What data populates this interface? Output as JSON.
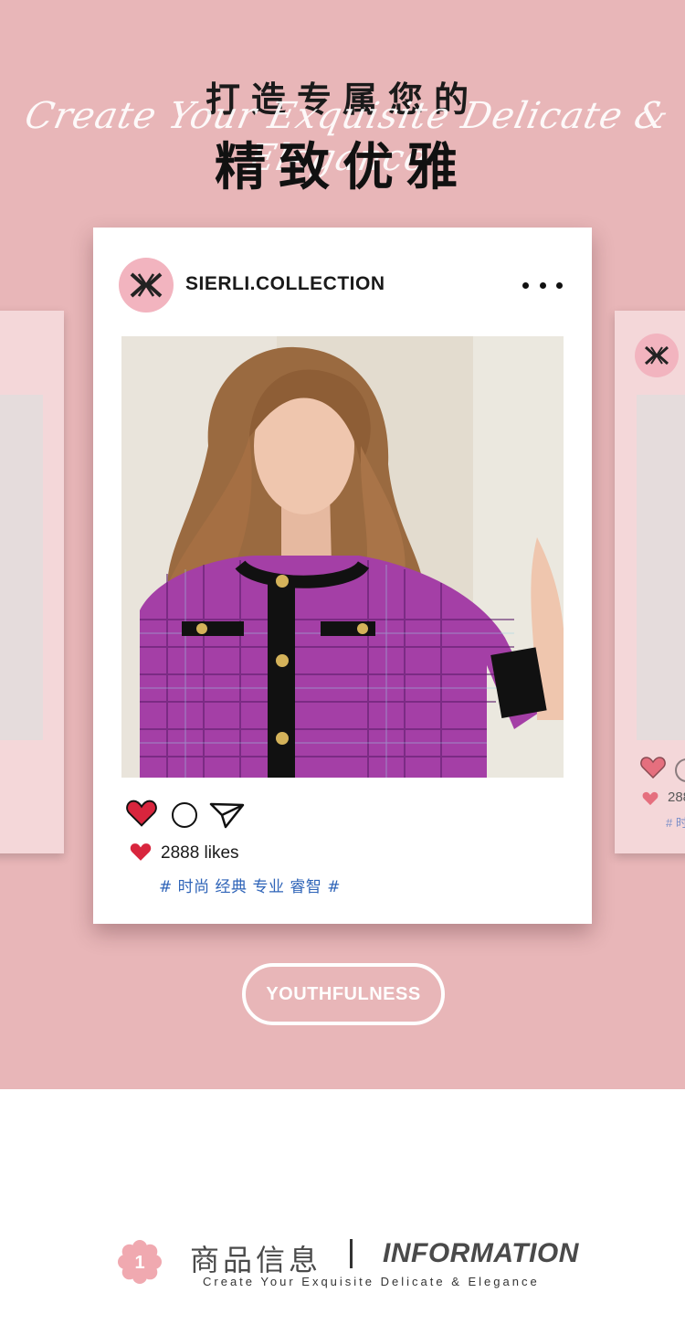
{
  "header": {
    "title_line1": "打造专属您的",
    "script_line": "Create Your Exquisite Delicate & Elegance",
    "title_line2": "精致优雅"
  },
  "post": {
    "account_name": "SIERLI.COLLECTION",
    "more_icon": "more-horizontal-icon",
    "actions": {
      "like_icon": "heart-icon",
      "comment_icon": "comment-icon",
      "share_icon": "send-icon"
    },
    "likes_text": "2888 likes",
    "hashtags": "# 时尚 经典 专业 睿智 #"
  },
  "side_card": {
    "likes_text": "288",
    "hashtag_fragment": "# 时"
  },
  "badge": {
    "label": "YOUTHFULNESS"
  },
  "info_section": {
    "number": "1",
    "title_cn": "商品信息",
    "title_en": "INFORMATION",
    "subtitle": "Create Your Exquisite Delicate & Elegance"
  },
  "colors": {
    "hero_background": "#e8b6b8",
    "heart": "#d8253d",
    "hashtag": "#2f64b8",
    "avatar_bg": "#f2b4bf",
    "flower": "#f0a9b0"
  }
}
